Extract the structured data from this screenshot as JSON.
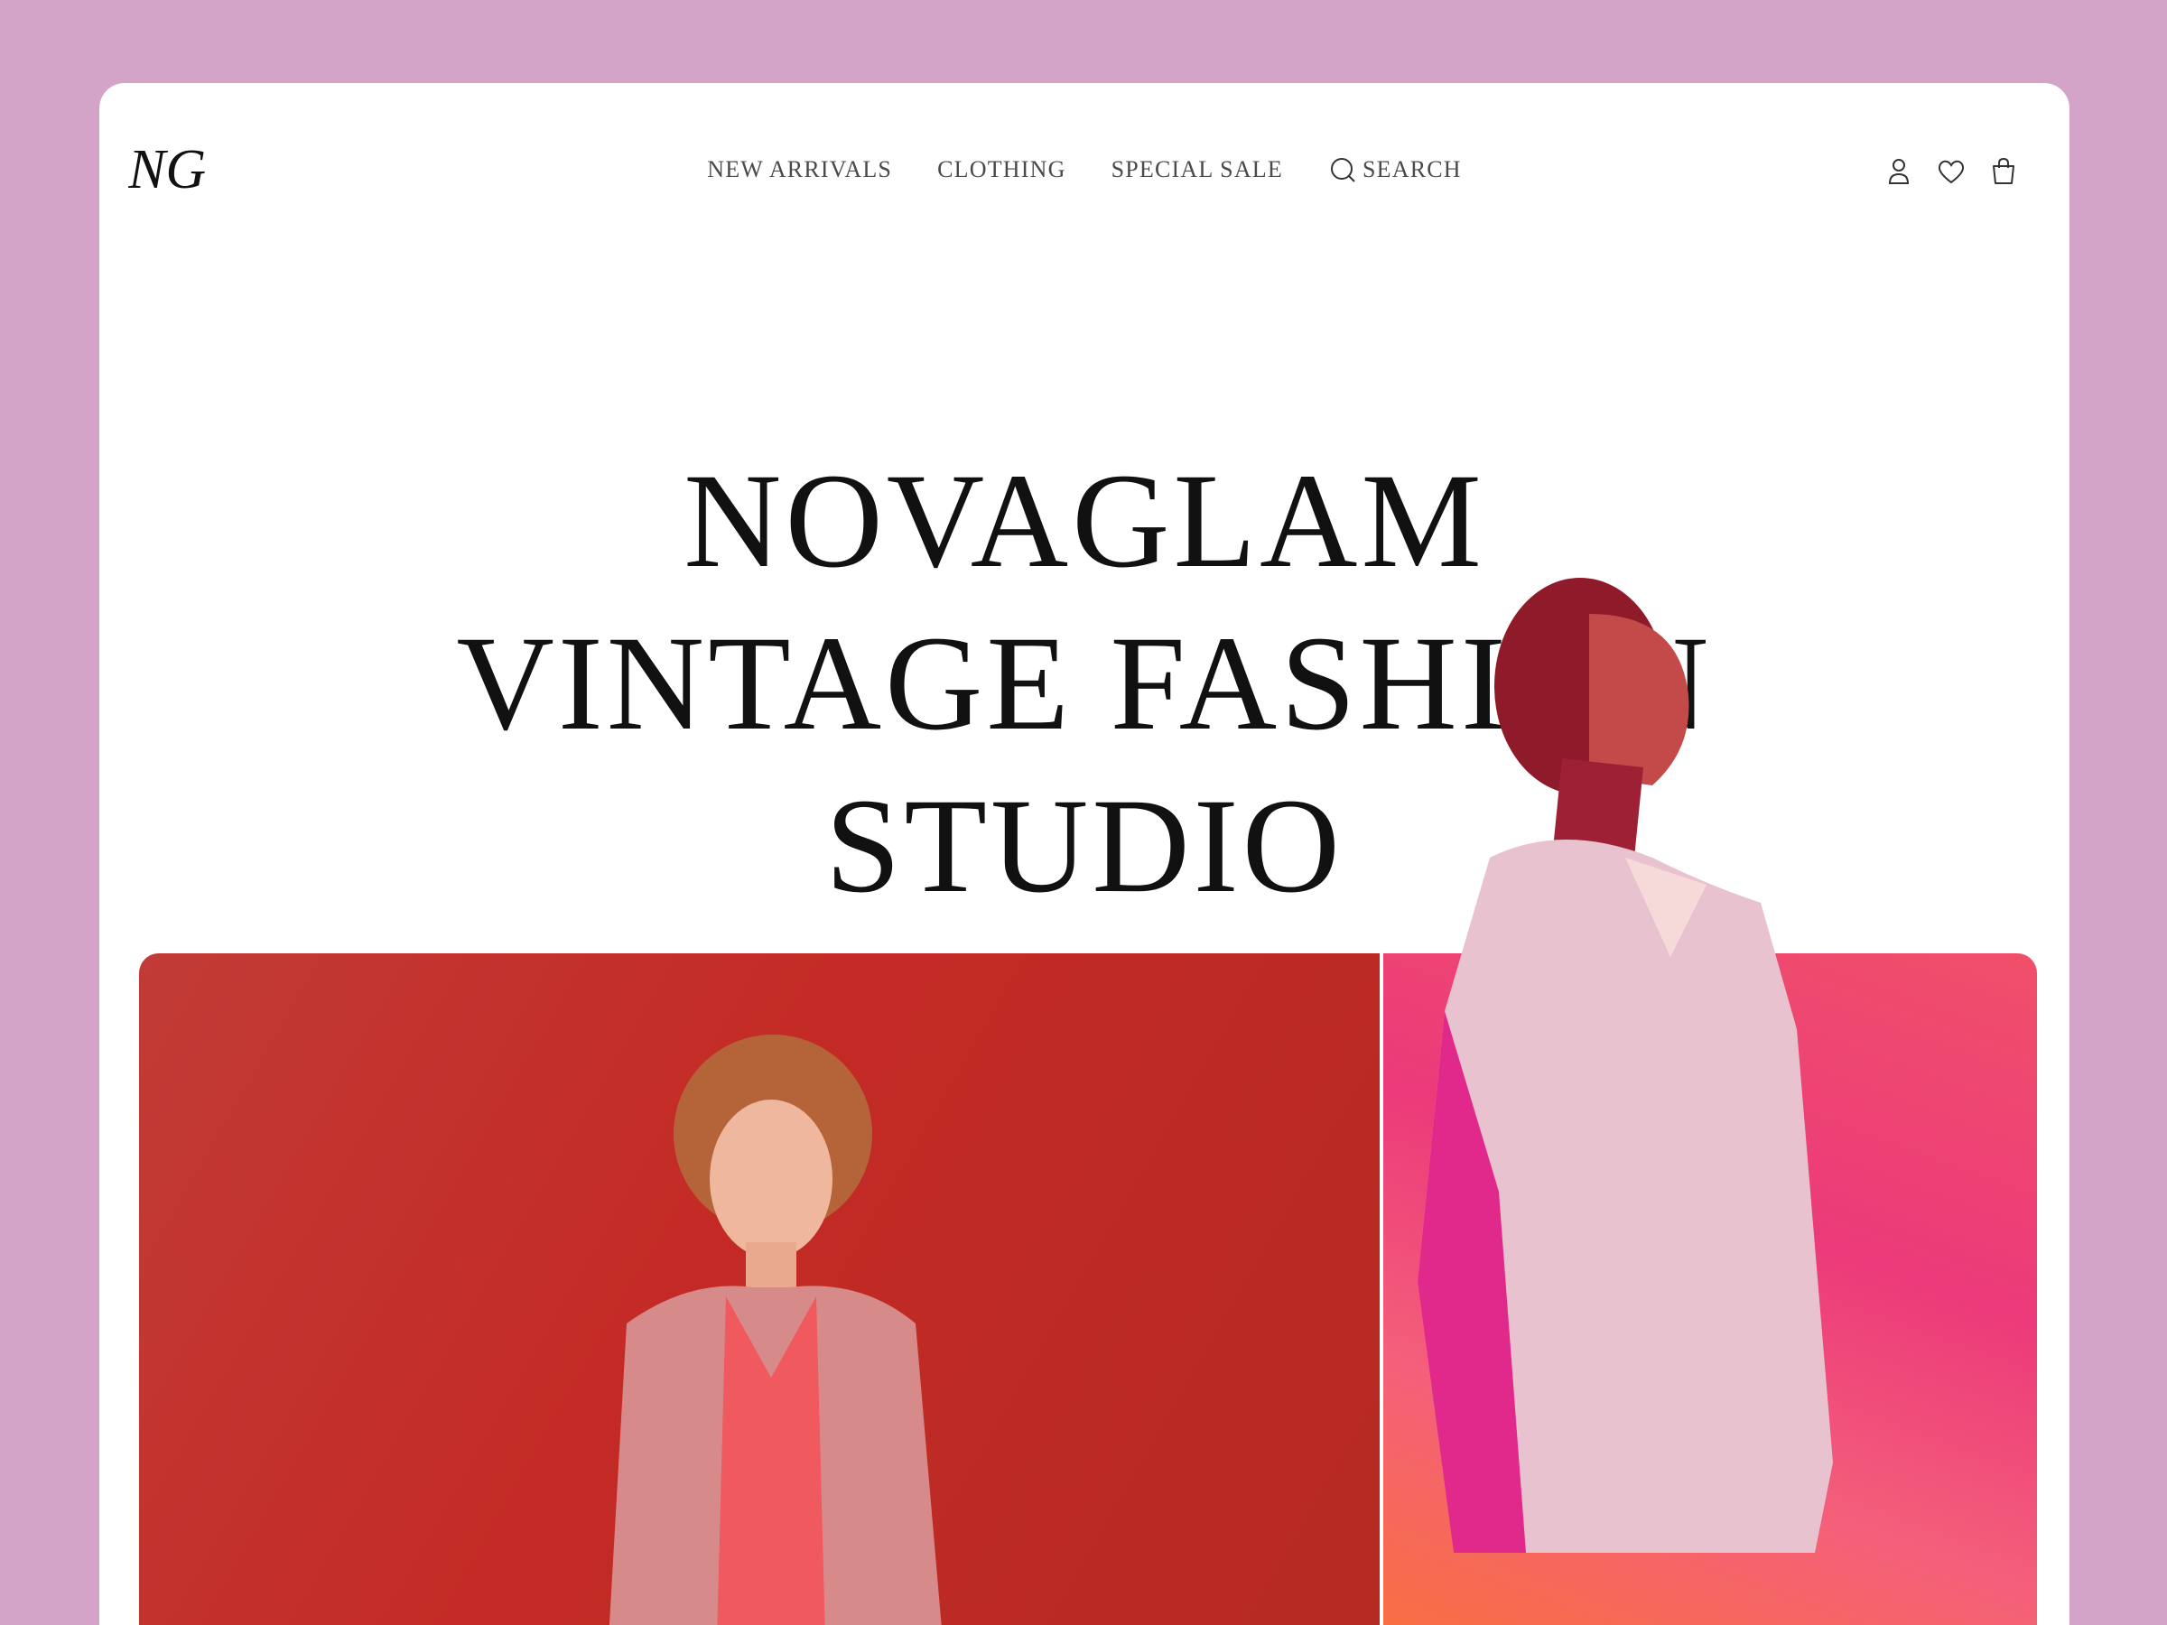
{
  "brand": {
    "logo_text": "NG",
    "accent": "#d4a3c8"
  },
  "nav": {
    "items": [
      {
        "label": "NEW ARRIVALS"
      },
      {
        "label": "CLOTHING"
      },
      {
        "label": "SPECIAL SALE"
      }
    ],
    "search_label": "SEARCH",
    "search_icon": "search-icon"
  },
  "header_icons": [
    "user-icon",
    "heart-icon",
    "bag-icon"
  ],
  "hero": {
    "line1": "NOVAGLAM",
    "line2": "VINTAGE FASHION",
    "line3": "STUDIO"
  },
  "colors": {
    "page_bg": "#d4a3c8",
    "left_photo_bg": "#c42a25",
    "right_photo_bg": "#ec3a7a"
  }
}
